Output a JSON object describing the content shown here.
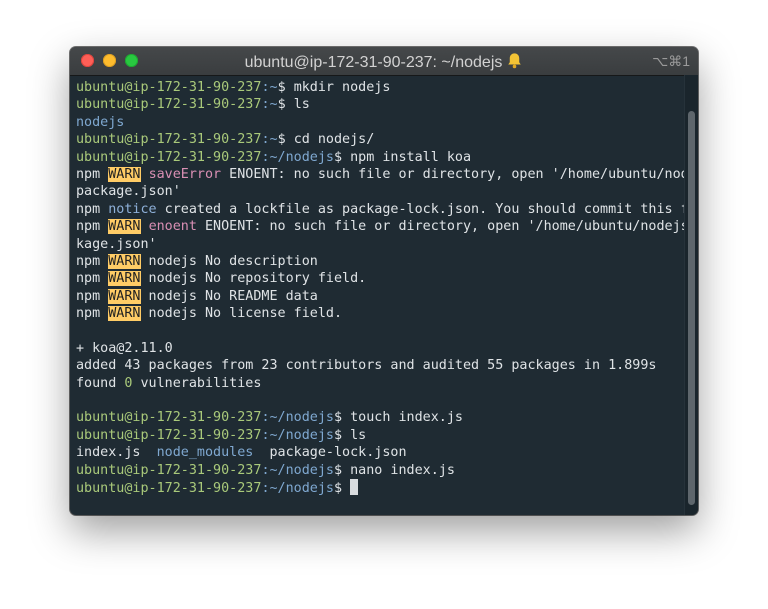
{
  "window": {
    "title": "ubuntu@ip-172-31-90-237: ~/nodejs",
    "shortcut": "⌥⌘1"
  },
  "terminal": {
    "lines": [
      {
        "user": "ubuntu@ip-172-31-90-237",
        "path": ":~",
        "dollar": "$ ",
        "cmd": "mkdir nodejs"
      },
      {
        "user": "ubuntu@ip-172-31-90-237",
        "path": ":~",
        "dollar": "$ ",
        "cmd": "ls"
      },
      {
        "dir": "nodejs"
      },
      {
        "user": "ubuntu@ip-172-31-90-237",
        "path": ":~",
        "dollar": "$ ",
        "cmd": "cd nodejs/"
      },
      {
        "user": "ubuntu@ip-172-31-90-237",
        "path": ":~/nodejs",
        "dollar": "$ ",
        "cmd": "npm install koa"
      },
      {
        "npm": "npm ",
        "tag": "WARN",
        "kind": "saveError",
        "msg": " ENOENT: no such file or directory, open '/home/ubuntu/nodejs/"
      },
      {
        "text": "package.json'"
      },
      {
        "npm": "npm ",
        "notice": "notice",
        "msg": " created a lockfile as package-lock.json. You should commit this file."
      },
      {
        "npm": "npm ",
        "tag": "WARN",
        "kind": "enoent",
        "msg": " ENOENT: no such file or directory, open '/home/ubuntu/nodejs/pac"
      },
      {
        "text": "kage.json'"
      },
      {
        "npm": "npm ",
        "tag": "WARN",
        "msg": " nodejs No description"
      },
      {
        "npm": "npm ",
        "tag": "WARN",
        "msg": " nodejs No repository field."
      },
      {
        "npm": "npm ",
        "tag": "WARN",
        "msg": " nodejs No README data"
      },
      {
        "npm": "npm ",
        "tag": "WARN",
        "msg": " nodejs No license field."
      },
      {
        "text": ""
      },
      {
        "text": "+ koa@2.11.0"
      },
      {
        "text": "added 43 packages from 23 contributors and audited 55 packages in 1.899s"
      },
      {
        "pre": "found ",
        "num": "0",
        "post": " vulnerabilities"
      },
      {
        "text": ""
      },
      {
        "user": "ubuntu@ip-172-31-90-237",
        "path": ":~/nodejs",
        "dollar": "$ ",
        "cmd": "touch index.js"
      },
      {
        "user": "ubuntu@ip-172-31-90-237",
        "path": ":~/nodejs",
        "dollar": "$ ",
        "cmd": "ls"
      },
      {
        "files": [
          {
            "name": "index.js",
            "dir": false
          },
          {
            "name": "node_modules",
            "dir": true
          },
          {
            "name": "package-lock.json",
            "dir": false
          }
        ]
      },
      {
        "user": "ubuntu@ip-172-31-90-237",
        "path": ":~/nodejs",
        "dollar": "$ ",
        "cmd": "nano index.js"
      },
      {
        "user": "ubuntu@ip-172-31-90-237",
        "path": ":~/nodejs",
        "dollar": "$ ",
        "cmd": "",
        "cursor": true
      }
    ]
  }
}
